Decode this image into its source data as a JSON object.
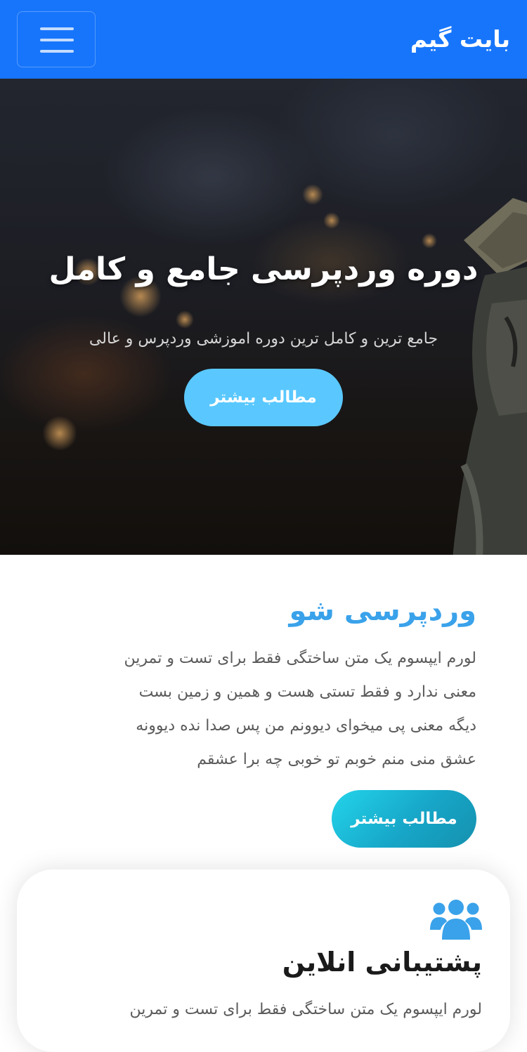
{
  "header": {
    "brand": "بایت گیم",
    "menu_icon": "hamburger-menu-icon",
    "background_color": "#1775fb"
  },
  "hero": {
    "title": "دوره وردپرسی جامع و کامل",
    "subtitle": "جامع ترین و کامل ترین دوره اموزشی وردپرس و عالی",
    "button_label": "مطالب بیشتر",
    "button_color": "#5ac8ff"
  },
  "section": {
    "title": "وردپرسی شو",
    "title_color": "#3aa2ea",
    "lines": [
      "لورم ایپسوم یک متن ساختگی فقط برای تست و تمرین",
      "معنی ندارد و فقط تستی هست و همین و زمین بست",
      "دیگه معنی پی میخوای دیوونم من پس صدا نده دیوونه",
      "عشق منی منم خوبم تو خوبی چه برا عشقم"
    ],
    "button_label": "مطالب بیشتر"
  },
  "feature_card": {
    "icon": "users-group-icon",
    "icon_color": "#3aa2ea",
    "title": "پشتیبانی انلاین",
    "text": "لورم ایپسوم یک متن ساختگی فقط برای تست و تمرین"
  }
}
